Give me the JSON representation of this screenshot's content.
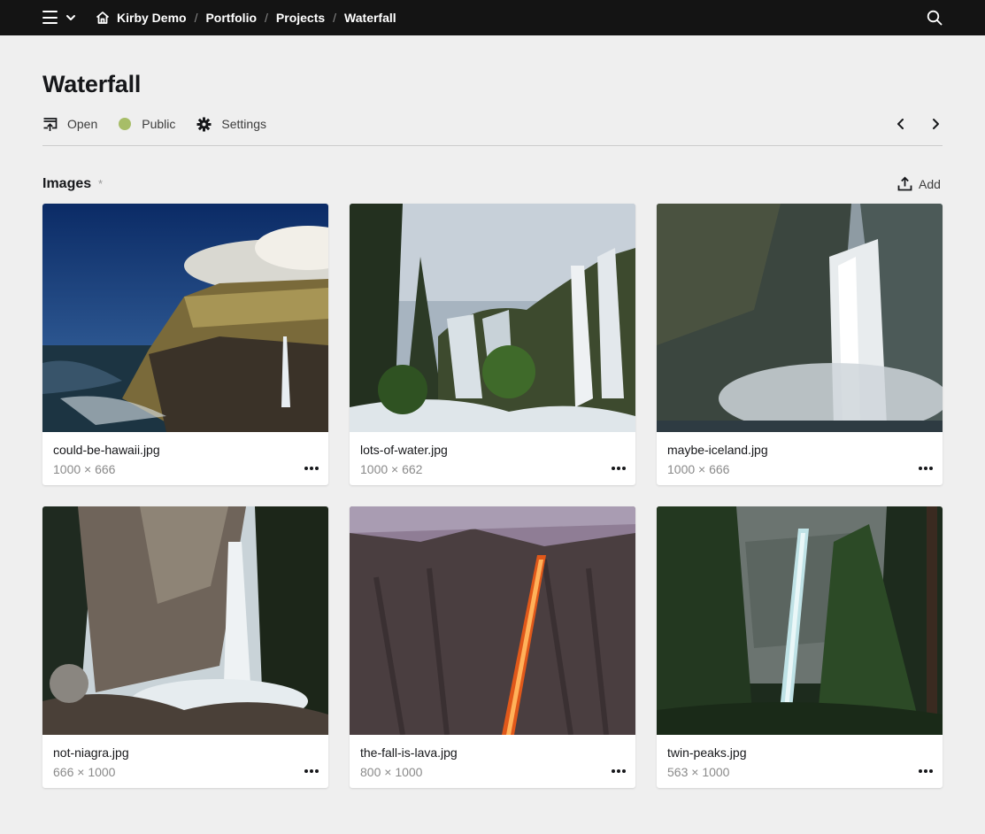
{
  "topbar": {
    "menu_icon": "hamburger-icon",
    "dropdown_icon": "chevron-down-icon",
    "home_icon": "home-icon",
    "search_icon": "search-icon",
    "breadcrumbs": [
      "Kirby Demo",
      "Portfolio",
      "Projects",
      "Waterfall"
    ],
    "separator": "/"
  },
  "header": {
    "title": "Waterfall",
    "options": {
      "open_label": "Open",
      "status_label": "Public",
      "settings_label": "Settings"
    },
    "status_color": "#a7bd68"
  },
  "section": {
    "label": "Images",
    "required_marker": "*",
    "add_label": "Add"
  },
  "files": [
    {
      "name": "could-be-hawaii.jpg",
      "info": "1000 × 666"
    },
    {
      "name": "lots-of-water.jpg",
      "info": "1000 × 662"
    },
    {
      "name": "maybe-iceland.jpg",
      "info": "1000 × 666"
    },
    {
      "name": "not-niagra.jpg",
      "info": "666 × 1000"
    },
    {
      "name": "the-fall-is-lava.jpg",
      "info": "800 × 1000"
    },
    {
      "name": "twin-peaks.jpg",
      "info": "563 × 1000"
    }
  ]
}
